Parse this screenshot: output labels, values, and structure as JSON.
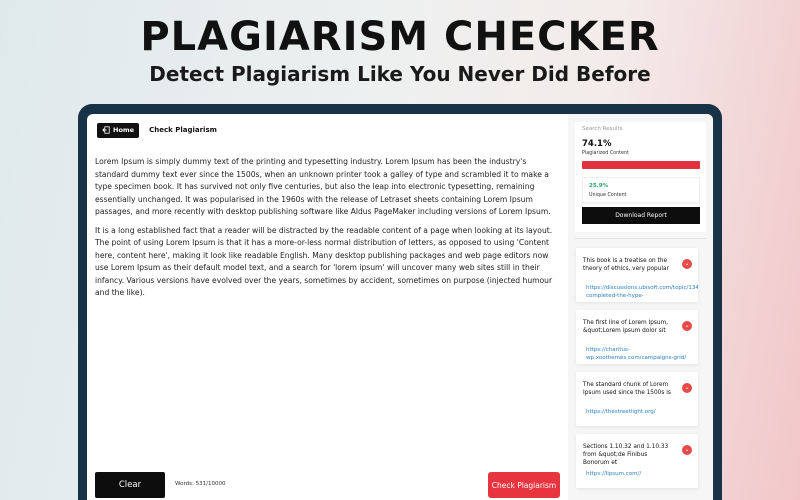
{
  "hero": {
    "title": "PLAGIARISM CHECKER",
    "subtitle": "Detect Plagiarism Like You Never Did Before"
  },
  "topbar": {
    "home_label": "Home",
    "page_title": "Check Plagiarism"
  },
  "editor": {
    "paragraphs": [
      "Lorem Ipsum is simply dummy text of the printing and typesetting industry. Lorem Ipsum has been the industry's standard dummy text ever since the 1500s, when an unknown printer took a galley of type and scrambled it to make a type specimen book. It has survived not only five centuries, but also the leap into electronic typesetting, remaining essentially unchanged. It was popularised in the 1960s with the release of Letraset sheets containing Lorem Ipsum passages, and more recently with desktop publishing software like Aldus PageMaker including versions of Lorem Ipsum.",
      "It is a long established fact that a reader will be distracted by the readable content of a page when looking at its layout. The point of using Lorem Ipsum is that it has a more-or-less normal distribution of letters, as opposed to using 'Content here, content here', making it look like readable English. Many desktop publishing packages and web page editors now use Lorem Ipsum as their default model text, and a search for 'lorem ipsum' will uncover many web sites still in their infancy. Various versions have evolved over the years, sometimes by accident, sometimes on purpose (injected humour and the like)."
    ]
  },
  "bottombar": {
    "clear_label": "Clear",
    "word_count": "Words: 531/10000",
    "check_label": "Check Plagiarism"
  },
  "results": {
    "heading": "Search Results",
    "plagiarized_pct": "74.1%",
    "plagiarized_fraction": 1.0,
    "plagiarized_label": "Plagiarized Content",
    "unique_pct": "25.9%",
    "unique_label": "Unique Content",
    "download_label": "Download Report"
  },
  "sources": [
    {
      "title": "This book is a treatise on the theory of ethics, very popular",
      "url": "https://discussions.ubisoft.com/topic/134430/-completed-the-hype-"
    },
    {
      "title": "The first line of Lorem Ipsum, &quot;Lorem ipsum dolor sit",
      "url": "https://charitus-wp.xoothemes.com/campaigns-grid/"
    },
    {
      "title": "The standard chunk of Lorem Ipsum used since the 1500s is",
      "url": "https://thestreetlight.org/"
    },
    {
      "title": "Sections 1.10.32 and 1.10.33 from &quot;de Finibus Bonorum et",
      "url": "https://lipsum.com//"
    }
  ],
  "colors": {
    "accent_red": "#e2313f",
    "unique_green": "#2aa56b",
    "frame": "#183248",
    "link_blue": "#2a7ec4"
  },
  "icons": {
    "home": "exit-door-icon",
    "source_badge": "chevron-down-icon"
  }
}
